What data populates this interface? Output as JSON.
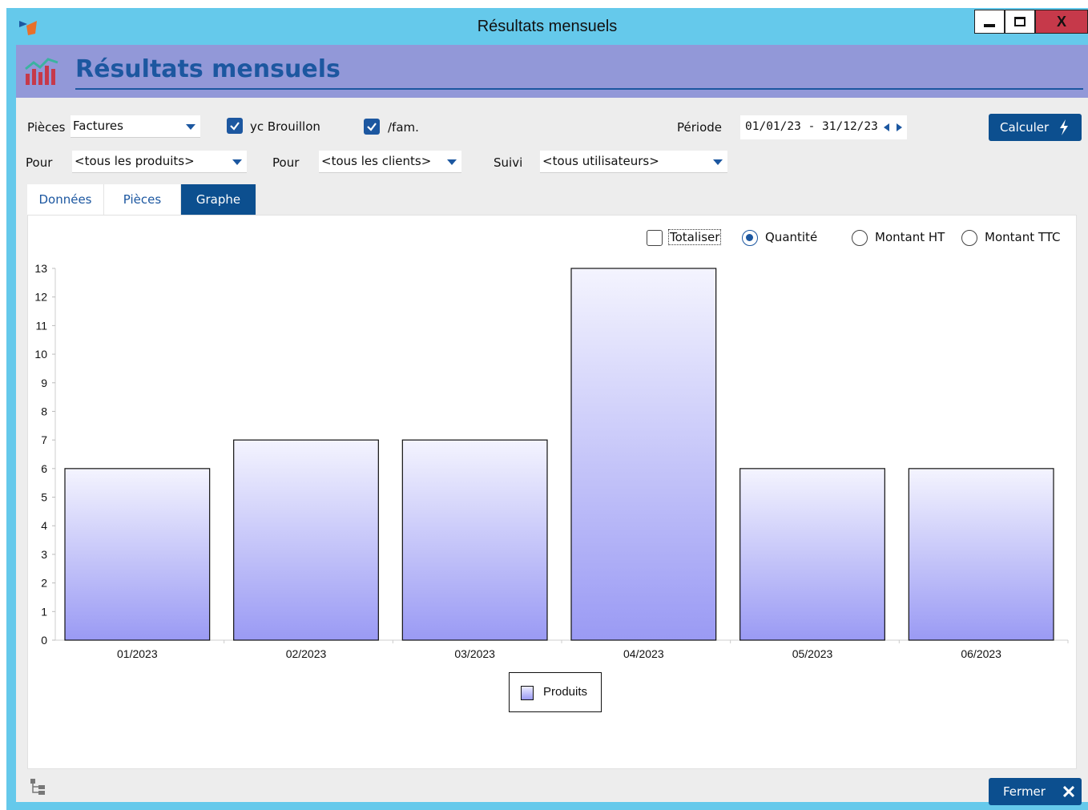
{
  "window": {
    "title": "Résultats mensuels",
    "minimize_label": "▁",
    "maximize_label": "□",
    "close_label": "X"
  },
  "header": {
    "title": "Résultats mensuels",
    "icon": "bar-chart-icon",
    "accent": "#1c57a0",
    "band_color": "#9298d8"
  },
  "filters": {
    "pieces_label": "Pièces",
    "pieces_value": "Factures",
    "yc_brouillon_label": "yc Brouillon",
    "yc_brouillon_checked": true,
    "fam_label": "/fam.",
    "fam_checked": true,
    "periode_label": "Période",
    "periode_value": "01/01/23 - 31/12/23",
    "pour_label": "Pour",
    "produits_value": "<tous les produits>",
    "pour2_label": "Pour",
    "clients_value": "<tous les clients>",
    "suivi_label": "Suivi",
    "suivi_value": "<tous utilisateurs>"
  },
  "buttons": {
    "calculer": "Calculer",
    "fermer": "Fermer"
  },
  "tabs": [
    {
      "label": "Données",
      "active": false
    },
    {
      "label": "Pièces",
      "active": false
    },
    {
      "label": "Graphe",
      "active": true
    }
  ],
  "options": {
    "totaliser": "Totaliser",
    "totaliser_checked": false,
    "quantite": "Quantité",
    "montant_ht": "Montant HT",
    "montant_ttc": "Montant TTC",
    "selected": "Quantité"
  },
  "chart_data": {
    "type": "bar",
    "categories": [
      "01/2023",
      "02/2023",
      "03/2023",
      "04/2023",
      "05/2023",
      "06/2023"
    ],
    "series": [
      {
        "name": "Produits",
        "values": [
          6,
          7,
          7,
          13,
          6,
          6
        ]
      }
    ],
    "ylim": [
      0,
      13
    ],
    "yticks": [
      0,
      1,
      2,
      3,
      4,
      5,
      6,
      7,
      8,
      9,
      10,
      11,
      12,
      13
    ],
    "legend": "bottom-center",
    "grid": false,
    "bar_top_color": "#f4f4fe",
    "bar_bottom_color": "#9a9af4"
  }
}
